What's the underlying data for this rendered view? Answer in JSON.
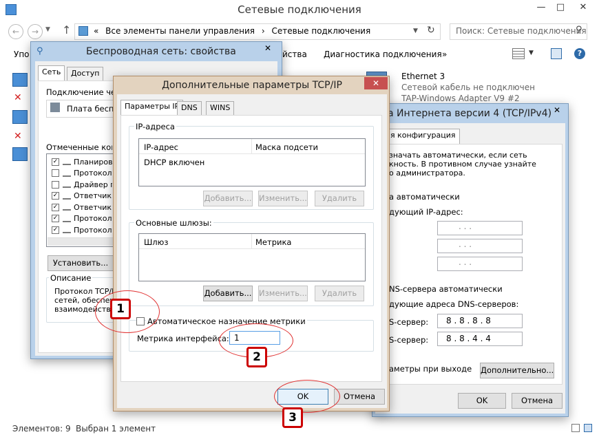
{
  "explorer": {
    "title": "Сетевые подключения",
    "address_sep": "«",
    "address_parts": [
      "Все элементы панели управления",
      "Сетевые подключения"
    ],
    "search_placeholder": "Поиск: Сетевые подключения",
    "cmd_partial_left": "Упо",
    "cmd_partial_properties": "йства",
    "cmd_diagnostics": "Диагностика подключения",
    "cmd_more": "»",
    "ethernet": {
      "name": "Ethernet 3",
      "status": "Сетевой кабель не подключен",
      "adapter": "TAP-Windows Adapter V9 #2"
    },
    "status_count": "Элементов: 9",
    "status_selected": "Выбран 1 элемент"
  },
  "wireless": {
    "title": "Беспроводная сеть: свойства",
    "tabs": [
      "Сеть",
      "Доступ"
    ],
    "connect_using_label": "Подключение через:",
    "adapter_name": "Плата беспроводной",
    "components_label": "Отмеченные компоненты",
    "components": [
      {
        "label": "Планировщик",
        "checked": true
      },
      {
        "label": "Протокол м",
        "checked": false
      },
      {
        "label": "Драйвер п",
        "checked": false
      },
      {
        "label": "Ответчик о",
        "checked": true
      },
      {
        "label": "Ответчик о",
        "checked": true
      },
      {
        "label": "Протокол I",
        "checked": true
      },
      {
        "label": "Протокол I",
        "checked": true
      }
    ],
    "install_button": "Установить...",
    "description_label": "Описание",
    "description_text": [
      "Протокол TCP/IP",
      "сетей, обеспечи",
      "взаимодейств"
    ]
  },
  "ipv4": {
    "title_partial": "а Интернета версии 4 (TCP/IPv4)",
    "tab_alt": "я конфигурация",
    "text_lines": [
      "значать автоматически, если сеть",
      "кность. В противном случае узнайте",
      "о администратора."
    ],
    "auto_ip": "а автоматически",
    "use_ip": "дующий IP-адрес:",
    "ip_placeholder": ".   .   .",
    "auto_dns": "NS-сервера автоматически",
    "use_dns": "дующие адреса DNS-серверов:",
    "dns1_label": "S-сервер:",
    "dns1": "8 . 8 . 8 . 8",
    "dns2_label": "S-сервер:",
    "dns2": "8 . 8 . 4 . 4",
    "validate_on_exit": "аметры при выходе",
    "advanced_button": "Дополнительно...",
    "ok": "OK",
    "cancel": "Отмена"
  },
  "advanced": {
    "title": "Дополнительные параметры TCP/IP",
    "tabs": [
      "Параметры IP",
      "DNS",
      "WINS"
    ],
    "ip_group_label": "IP-адреса",
    "ip_columns": [
      "IP-адрес",
      "Маска подсети"
    ],
    "ip_row": "DHCP включен",
    "gateway_group_label": "Основные шлюзы:",
    "gateway_columns": [
      "Шлюз",
      "Метрика"
    ],
    "add": "Добавить...",
    "edit": "Изменить...",
    "remove": "Удалить",
    "auto_metric_label": "Автоматическое назначение метрики",
    "auto_metric_checked": false,
    "metric_label": "Метрика интерфейса:",
    "metric_value": "1",
    "ok": "OK",
    "cancel": "Отмена"
  },
  "annotations": {
    "one": "1",
    "two": "2",
    "three": "3"
  },
  "colors": {
    "accent_red": "#cc0000",
    "close_red": "#c75050"
  }
}
